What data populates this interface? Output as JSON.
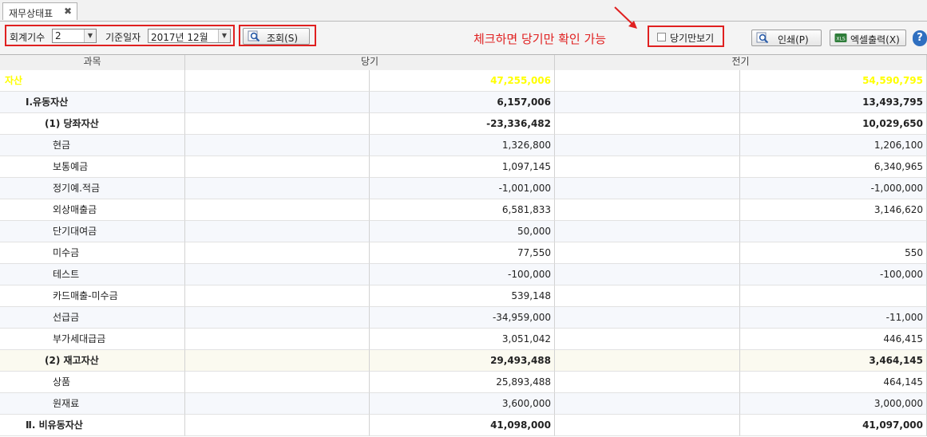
{
  "tab": {
    "title": "재무상태표",
    "close": "✖"
  },
  "toolbar": {
    "fiscal_label": "회계기수",
    "fiscal_value": "2",
    "date_label": "기준일자",
    "date_value": "2017년 12월",
    "search_button": "조회(S)",
    "annotation": "체크하면 당기만 확인 가능",
    "current_only_label": "당기만보기",
    "current_only_checked": false,
    "print_button": "인쇄(P)",
    "excel_button": "엑셀출력(X)",
    "help": "?",
    "annotation_color": "#e02020"
  },
  "table": {
    "headers": [
      "과목",
      "당기",
      "전기"
    ],
    "rows": [
      {
        "name": "자산",
        "current": "47,255,006",
        "previous": "54,590,795",
        "level": 0
      },
      {
        "name": "Ⅰ.유동자산",
        "current": "6,157,006",
        "previous": "13,493,795",
        "level": 1
      },
      {
        "name": "(1) 당좌자산",
        "current": "-23,336,482",
        "previous": "10,029,650",
        "level": 2
      },
      {
        "name": "현금",
        "current": "1,326,800",
        "previous": "1,206,100",
        "level": 3
      },
      {
        "name": "보통예금",
        "current": "1,097,145",
        "previous": "6,340,965",
        "level": 3
      },
      {
        "name": "정기예.적금",
        "current": "-1,001,000",
        "previous": "-1,000,000",
        "level": 3
      },
      {
        "name": "외상매출금",
        "current": "6,581,833",
        "previous": "3,146,620",
        "level": 3
      },
      {
        "name": "단기대여금",
        "current": "50,000",
        "previous": "",
        "level": 3
      },
      {
        "name": "미수금",
        "current": "77,550",
        "previous": "550",
        "level": 3
      },
      {
        "name": "테스트",
        "current": "-100,000",
        "previous": "-100,000",
        "level": 3
      },
      {
        "name": "카드매출-미수금",
        "current": "539,148",
        "previous": "",
        "level": 3
      },
      {
        "name": "선급금",
        "current": "-34,959,000",
        "previous": "-11,000",
        "level": 3
      },
      {
        "name": "부가세대급금",
        "current": "3,051,042",
        "previous": "446,415",
        "level": 3
      },
      {
        "name": "(2) 재고자산",
        "current": "29,493,488",
        "previous": "3,464,145",
        "level": 2
      },
      {
        "name": "상품",
        "current": "25,893,488",
        "previous": "464,145",
        "level": 3
      },
      {
        "name": "원재료",
        "current": "3,600,000",
        "previous": "3,000,000",
        "level": 3
      },
      {
        "name": "Ⅱ. 비유동자산",
        "current": "41,098,000",
        "previous": "41,097,000",
        "level": 1
      }
    ]
  }
}
